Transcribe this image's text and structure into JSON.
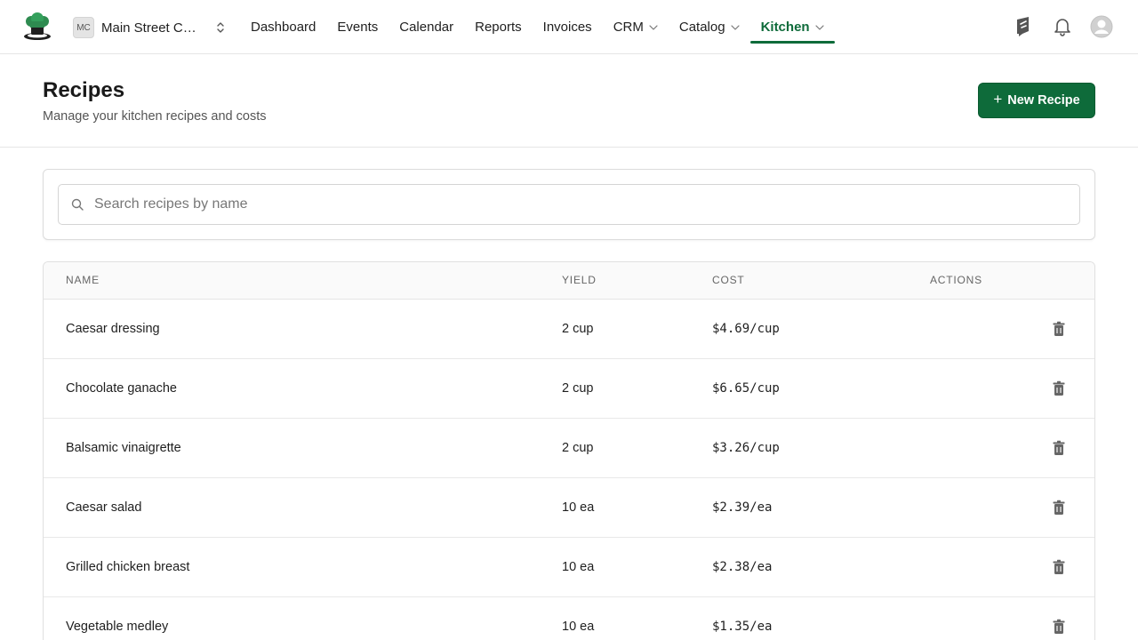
{
  "org": {
    "initials": "MC",
    "name": "Main Street Café"
  },
  "nav": [
    {
      "label": "Dashboard",
      "dropdown": false,
      "active": false
    },
    {
      "label": "Events",
      "dropdown": false,
      "active": false
    },
    {
      "label": "Calendar",
      "dropdown": false,
      "active": false
    },
    {
      "label": "Reports",
      "dropdown": false,
      "active": false
    },
    {
      "label": "Invoices",
      "dropdown": false,
      "active": false
    },
    {
      "label": "CRM",
      "dropdown": true,
      "active": false
    },
    {
      "label": "Catalog",
      "dropdown": true,
      "active": false
    },
    {
      "label": "Kitchen",
      "dropdown": true,
      "active": true
    }
  ],
  "top_icons": [
    "megaphone-icon",
    "bell-icon",
    "user-avatar-icon"
  ],
  "header": {
    "title": "Recipes",
    "subtitle": "Manage your kitchen recipes and costs",
    "new_button": "New Recipe"
  },
  "search": {
    "placeholder": "Search recipes by name",
    "value": ""
  },
  "table": {
    "columns": [
      "NAME",
      "YIELD",
      "COST",
      "ACTIONS"
    ],
    "rows": [
      {
        "name": "Caesar dressing",
        "yield": "2 cup",
        "cost": "$4.69/cup"
      },
      {
        "name": "Chocolate ganache",
        "yield": "2 cup",
        "cost": "$6.65/cup"
      },
      {
        "name": "Balsamic vinaigrette",
        "yield": "2 cup",
        "cost": "$3.26/cup"
      },
      {
        "name": "Caesar salad",
        "yield": "10 ea",
        "cost": "$2.39/ea"
      },
      {
        "name": "Grilled chicken breast",
        "yield": "10 ea",
        "cost": "$2.38/ea"
      },
      {
        "name": "Vegetable medley",
        "yield": "10 ea",
        "cost": "$1.35/ea"
      }
    ]
  },
  "colors": {
    "accent": "#0e6b3a",
    "border": "#e5e5e5",
    "muted_text": "#555555"
  }
}
